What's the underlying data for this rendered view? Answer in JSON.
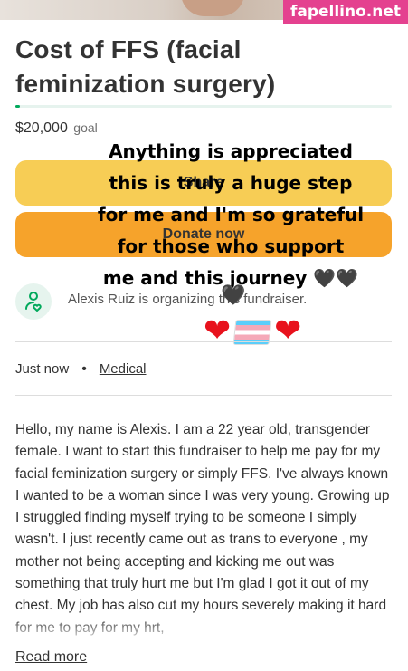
{
  "watermark": "fapellino.net",
  "fundraiser": {
    "title": "Cost of FFS (facial feminization surgery)",
    "progress_fraction": 0.012,
    "goal_amount": "$20,000",
    "goal_label": "goal",
    "share_label": "Share",
    "donate_label": "Donate now"
  },
  "caption": {
    "line1": "Anything is appreciated",
    "line2": "this is truly a huge step",
    "line3": "for me and I'm so grateful",
    "line4": "for those who support",
    "line5": "me and this journey 🖤🖤"
  },
  "organizer": {
    "text": "Alexis Ruiz is organizing this fundraiser."
  },
  "meta": {
    "time": "Just now",
    "category": "Medical"
  },
  "story": {
    "text": "Hello, my name is Alexis. I am a 22 year old, transgender female. I want to start this fundraiser to help me pay for my facial feminization surgery or simply FFS. I've always known I wanted to be a woman since I was very young. Growing up I struggled finding myself trying to be someone I simply wasn't. I just recently came out as trans to everyone , my mother not being accepting and kicking me out was something that truly hurt me but I'm glad I got it out of my chest. My job has also cut my hours severely making it hard for me to pay for my hrt,",
    "read_more": "Read more"
  },
  "colors": {
    "brand_green": "#02a95c",
    "share_yellow": "#f7cd55",
    "donate_orange": "#f6a32b",
    "watermark_pink": "#e4418f"
  }
}
